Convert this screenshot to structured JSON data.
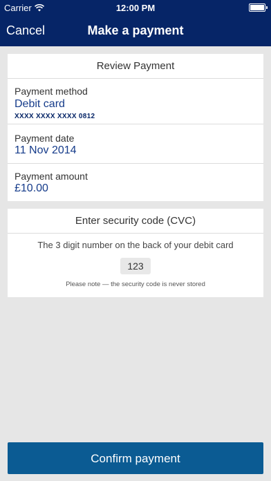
{
  "status_bar": {
    "carrier": "Carrier",
    "time": "12:00 PM"
  },
  "nav": {
    "cancel_label": "Cancel",
    "title": "Make a payment"
  },
  "review": {
    "header": "Review Payment",
    "method_label": "Payment method",
    "method_value": "Debit card",
    "card_number": "XXXX XXXX XXXX 0812",
    "date_label": "Payment date",
    "date_value": "11 Nov 2014",
    "amount_label": "Payment amount",
    "amount_value": "£10.00"
  },
  "security": {
    "header": "Enter security code (CVC)",
    "instruction": "The 3 digit number on the back of your debit card",
    "cvc_value": "123",
    "note": "Please note — the security code is never stored"
  },
  "confirm_label": "Confirm payment",
  "colors": {
    "header_bg": "#062567",
    "accent_text": "#153b8a",
    "button_bg": "#0b5b93",
    "page_bg": "#e6e6e6"
  }
}
